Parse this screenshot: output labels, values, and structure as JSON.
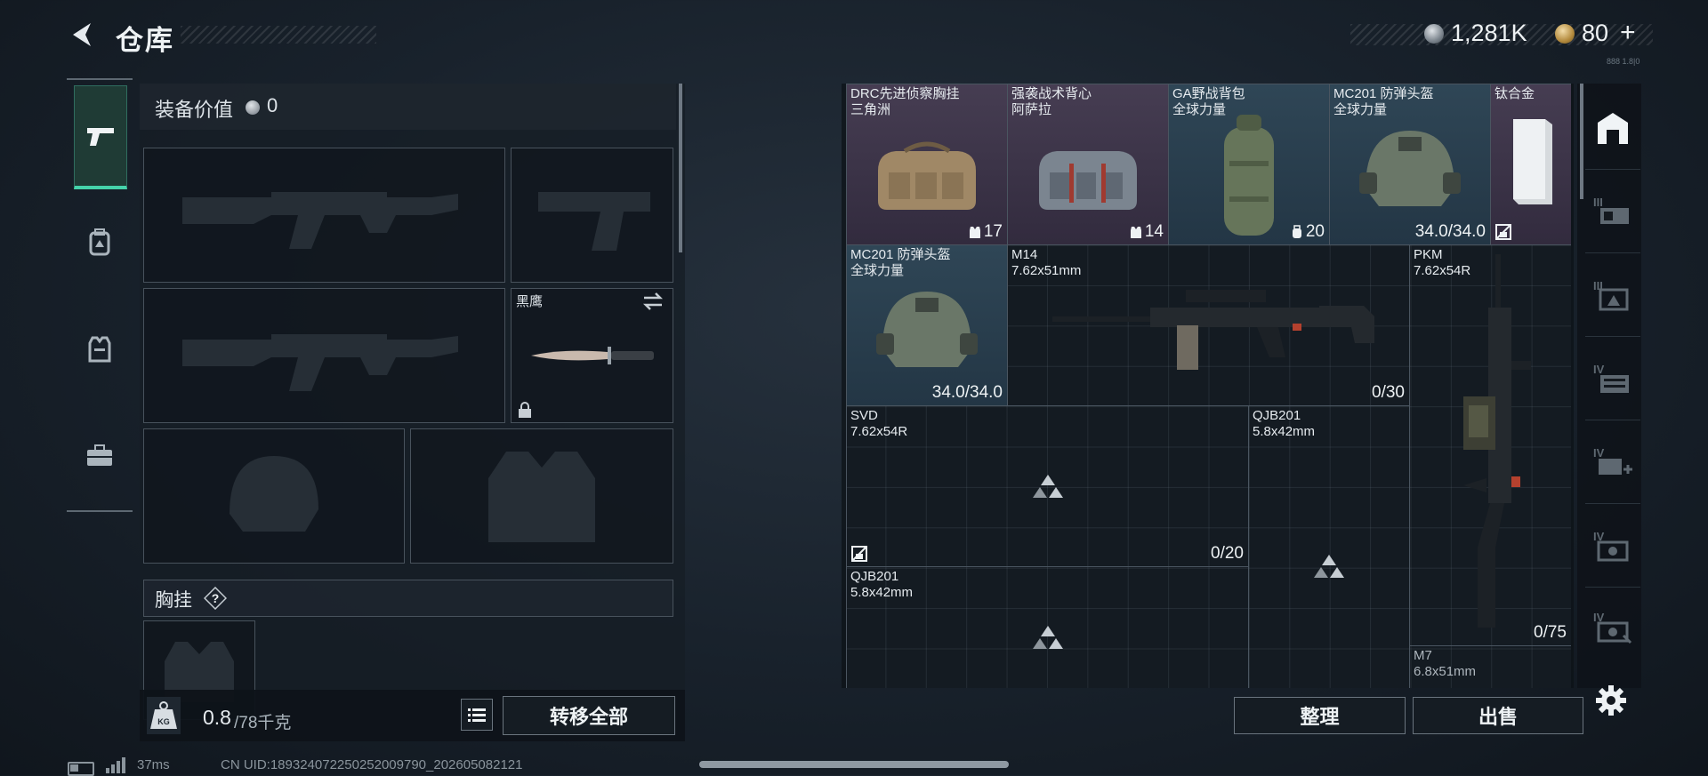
{
  "header": {
    "title": "仓库"
  },
  "currency": {
    "silver": "1,281K",
    "gold": "80",
    "gold_plus": "+"
  },
  "top_right_code": "888 1.8|0",
  "left_tabs": [
    {
      "name": "weapon-tab",
      "icon": "pistol-icon",
      "active": true
    },
    {
      "name": "backpack-tab",
      "icon": "backpack-icon",
      "active": false
    },
    {
      "name": "vest-tab",
      "icon": "vest-icon",
      "active": false
    },
    {
      "name": "case-tab",
      "icon": "briefcase-icon",
      "active": false
    }
  ],
  "loadout": {
    "equipment_value_label": "装备价值",
    "equipment_value": "0",
    "melee_name": "黑鹰",
    "chest_rig_label": "胸挂",
    "chest_rig_help": "?",
    "weight_current": "0.8",
    "weight_max": "/78千克",
    "weight_icon_text": "KG",
    "transfer_all": "转移全部"
  },
  "stash": {
    "items": [
      {
        "name": "DRC先进侦察胸挂",
        "sub": "三角洲",
        "badge": "17",
        "badge_icon": "vest-icon",
        "rarity": "purple"
      },
      {
        "name": "强袭战术背心",
        "sub": "阿萨拉",
        "badge": "14",
        "badge_icon": "vest-icon",
        "rarity": "purple"
      },
      {
        "name": "GA野战背包",
        "sub": "全球力量",
        "badge": "20",
        "badge_icon": "backpack-icon",
        "rarity": "blue"
      },
      {
        "name": "MC201 防弹头盔",
        "sub": "全球力量",
        "badge": "34.0/34.0",
        "badge_icon": "",
        "rarity": "blue"
      },
      {
        "name": "钛合金",
        "sub": "",
        "badge": "",
        "badge_icon": "no-sell-icon",
        "rarity": "purple"
      },
      {
        "name": "MC201 防弹头盔",
        "sub": "全球力量",
        "badge": "34.0/34.0",
        "badge_icon": "",
        "rarity": "blue"
      },
      {
        "name": "M14",
        "sub": "7.62x51mm",
        "badge": "0/30",
        "badge_icon": "",
        "rarity": "none"
      },
      {
        "name": "PKM",
        "sub": "7.62x54R",
        "badge": "0/75",
        "badge_icon": "",
        "rarity": "none"
      },
      {
        "name": "SVD",
        "sub": "7.62x54R",
        "badge": "0/20",
        "badge_icon": "",
        "rarity": "none"
      },
      {
        "name": "QJB201",
        "sub": "5.8x42mm",
        "badge": "",
        "badge_icon": "",
        "rarity": "none"
      },
      {
        "name": "QJB201",
        "sub": "5.8x42mm",
        "badge": "",
        "badge_icon": "",
        "rarity": "none"
      },
      {
        "name": "M7",
        "sub": "6.8x51mm",
        "badge": "",
        "badge_icon": "",
        "rarity": "none"
      }
    ]
  },
  "right_rail": {
    "items": [
      {
        "name": "armory-icon",
        "tier": ""
      },
      {
        "name": "storage-iii-icon",
        "tier": "III"
      },
      {
        "name": "storage-iii-b-icon",
        "tier": "III"
      },
      {
        "name": "storage-iv-icon",
        "tier": "IV"
      },
      {
        "name": "storage-iv-plus-icon",
        "tier": "IV"
      },
      {
        "name": "storage-iv-b-icon",
        "tier": "IV"
      },
      {
        "name": "storage-iv-c-icon",
        "tier": "IV"
      }
    ]
  },
  "buttons": {
    "organize": "整理",
    "sell": "出售"
  },
  "status": {
    "ping": "37ms",
    "uid": "CN UID:18932407225025200979​0_202605082121"
  },
  "colors": {
    "accent": "#45d3aa",
    "rarity_purple": "#463d52",
    "rarity_blue": "#2f4656"
  }
}
